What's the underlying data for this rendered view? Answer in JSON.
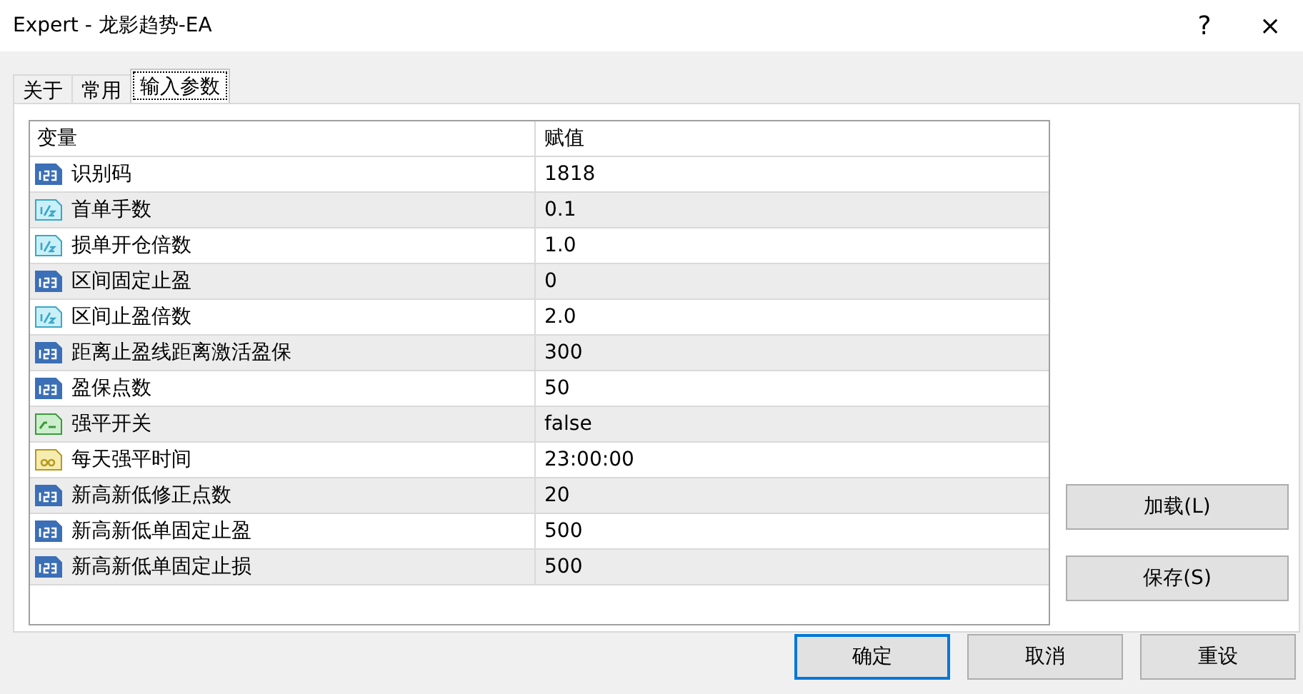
{
  "window": {
    "title": "Expert - 龙影趋势-EA",
    "help": "?",
    "close": "×"
  },
  "tabs": [
    {
      "label": "关于",
      "selected": false
    },
    {
      "label": "常用",
      "selected": false
    },
    {
      "label": "输入参数",
      "selected": true
    }
  ],
  "table": {
    "columns": [
      "变量",
      "赋值"
    ],
    "rows": [
      {
        "kind": "int",
        "name": "识别码",
        "value": "1818"
      },
      {
        "kind": "double",
        "name": "首单手数",
        "value": "0.1"
      },
      {
        "kind": "double",
        "name": "损单开仓倍数",
        "value": "1.0"
      },
      {
        "kind": "int",
        "name": "区间固定止盈",
        "value": "0"
      },
      {
        "kind": "double",
        "name": "区间止盈倍数",
        "value": "2.0"
      },
      {
        "kind": "int",
        "name": "距离止盈线距离激活盈保",
        "value": "300"
      },
      {
        "kind": "int",
        "name": "盈保点数",
        "value": "50"
      },
      {
        "kind": "bool",
        "name": "强平开关",
        "value": "false"
      },
      {
        "kind": "string",
        "name": "每天强平时间",
        "value": "23:00:00"
      },
      {
        "kind": "int",
        "name": "新高新低修正点数",
        "value": "20"
      },
      {
        "kind": "int",
        "name": "新高新低单固定止盈",
        "value": "500"
      },
      {
        "kind": "int",
        "name": "新高新低单固定止损",
        "value": "500"
      }
    ]
  },
  "side_buttons": [
    "加载(L)",
    "保存(S)"
  ],
  "footer_buttons": [
    {
      "label": "确定",
      "selected": true
    },
    {
      "label": "取消",
      "selected": false
    },
    {
      "label": "重设",
      "selected": false
    }
  ]
}
